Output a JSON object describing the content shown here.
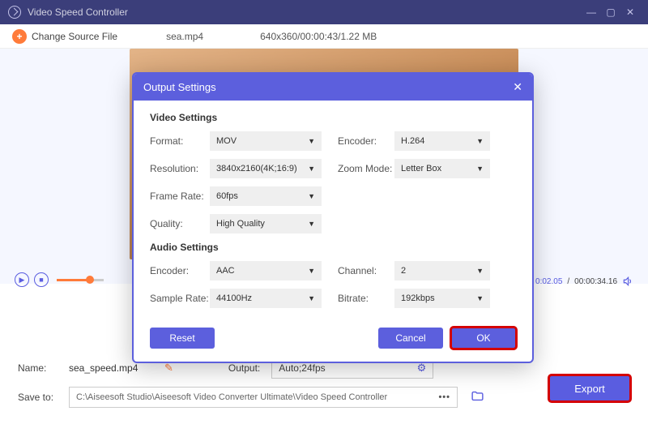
{
  "titlebar": {
    "title": "Video Speed Controller"
  },
  "toolbar": {
    "change_label": "Change Source File",
    "filename": "sea.mp4",
    "fileinfo": "640x360/00:00:43/1.22 MB"
  },
  "player": {
    "time_current": "0:02.05",
    "time_total": "00:00:34.16"
  },
  "dialog": {
    "title": "Output Settings",
    "video_section": "Video Settings",
    "audio_section": "Audio Settings",
    "labels": {
      "format": "Format:",
      "encoder": "Encoder:",
      "resolution": "Resolution:",
      "zoom": "Zoom Mode:",
      "framerate": "Frame Rate:",
      "quality": "Quality:",
      "aencoder": "Encoder:",
      "channel": "Channel:",
      "samplerate": "Sample Rate:",
      "bitrate": "Bitrate:"
    },
    "values": {
      "format": "MOV",
      "encoder": "H.264",
      "resolution": "3840x2160(4K;16:9)",
      "zoom": "Letter Box",
      "framerate": "60fps",
      "quality": "High Quality",
      "aencoder": "AAC",
      "channel": "2",
      "samplerate": "44100Hz",
      "bitrate": "192kbps"
    },
    "buttons": {
      "reset": "Reset",
      "cancel": "Cancel",
      "ok": "OK"
    }
  },
  "bottom": {
    "name_label": "Name:",
    "name_value": "sea_speed.mp4",
    "output_label": "Output:",
    "output_value": "Auto;24fps",
    "saveto_label": "Save to:",
    "saveto_path": "C:\\Aiseesoft Studio\\Aiseesoft Video Converter Ultimate\\Video Speed Controller",
    "export": "Export"
  }
}
